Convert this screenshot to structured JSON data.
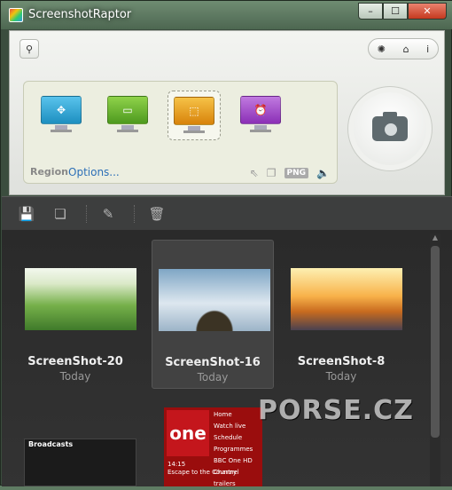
{
  "window": {
    "title": "ScreenshotRaptor",
    "close_glyph": "✕",
    "max_glyph": "☐",
    "min_glyph": "–"
  },
  "panel": {
    "pin_icon": "pin-icon",
    "settings_icon": "gear-icon",
    "home_icon": "home-icon",
    "info_icon": "info-icon",
    "modes": [
      {
        "name": "fullscreen",
        "color": "#2aa6d8",
        "glyph": "✥"
      },
      {
        "name": "window",
        "color": "#6fb12e",
        "glyph": "▭"
      },
      {
        "name": "region",
        "color": "#e79b0f",
        "glyph": "⬚"
      },
      {
        "name": "timed",
        "color": "#9b3fc6",
        "glyph": "⏰"
      }
    ],
    "region_label": "Region",
    "options_label": "Options...",
    "format_label": "PNG"
  },
  "gallery": {
    "items": [
      {
        "name": "ScreenShot-20",
        "date": "Today"
      },
      {
        "name": "ScreenShot-16",
        "date": "Today"
      },
      {
        "name": "ScreenShot-8",
        "date": "Today"
      }
    ],
    "broadcasts": {
      "title": "Broadcasts"
    },
    "bbc": {
      "logo": "one",
      "menu": [
        "Home",
        "Watch live",
        "Schedule",
        "Programmes",
        "BBC One HD",
        "Channel trailers"
      ],
      "caption_time": "14:15",
      "caption_text": "Escape to the Country"
    }
  },
  "watermark": "PORSE.CZ"
}
